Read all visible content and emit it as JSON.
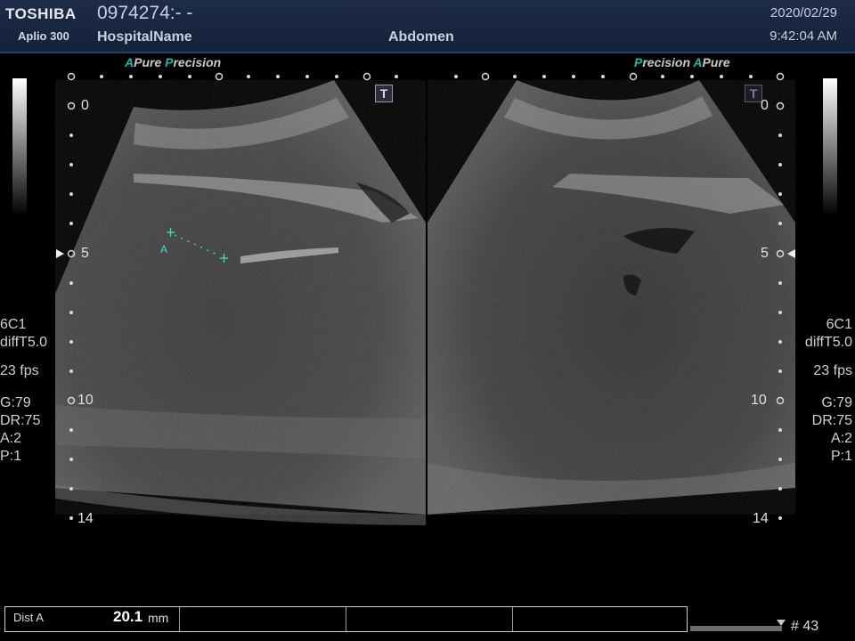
{
  "header": {
    "brand": "TOSHIBA",
    "model": "Aplio 300",
    "patient_id": "0974274:- -",
    "hospital": "HospitalName",
    "exam": "Abdomen",
    "date": "2020/02/29",
    "time": "9:42:04 AM"
  },
  "image_labels": {
    "left_a": "A",
    "left_pure": "Pure",
    "left_p": "P",
    "left_precision": "recision",
    "right_p": "P",
    "right_precision": "recision",
    "right_a": "A",
    "right_pure": "Pure"
  },
  "left_panel": {
    "probe": "6C1",
    "mode": "diffT5.0",
    "fps": "23 fps",
    "gain": "G:79",
    "dr": "DR:75",
    "a": "A:2",
    "p": "P:1"
  },
  "right_panel": {
    "probe": "6C1",
    "mode": "diffT5.0",
    "fps": "23 fps",
    "gain": "G:79",
    "dr": "DR:75",
    "a": "A:2",
    "p": "P:1"
  },
  "depth_scale": {
    "d0": "0",
    "d5": "5",
    "d10": "10",
    "d14": "14"
  },
  "t_mark": "T",
  "caliper_label": "A",
  "measurement": {
    "name": "Dist A",
    "value": "20.1",
    "unit": "mm"
  },
  "frame_number": "# 43",
  "colors": {
    "accent_teal": "#18b9a6",
    "header_bg": "#1a2844",
    "caliper": "#3fe0c0"
  }
}
